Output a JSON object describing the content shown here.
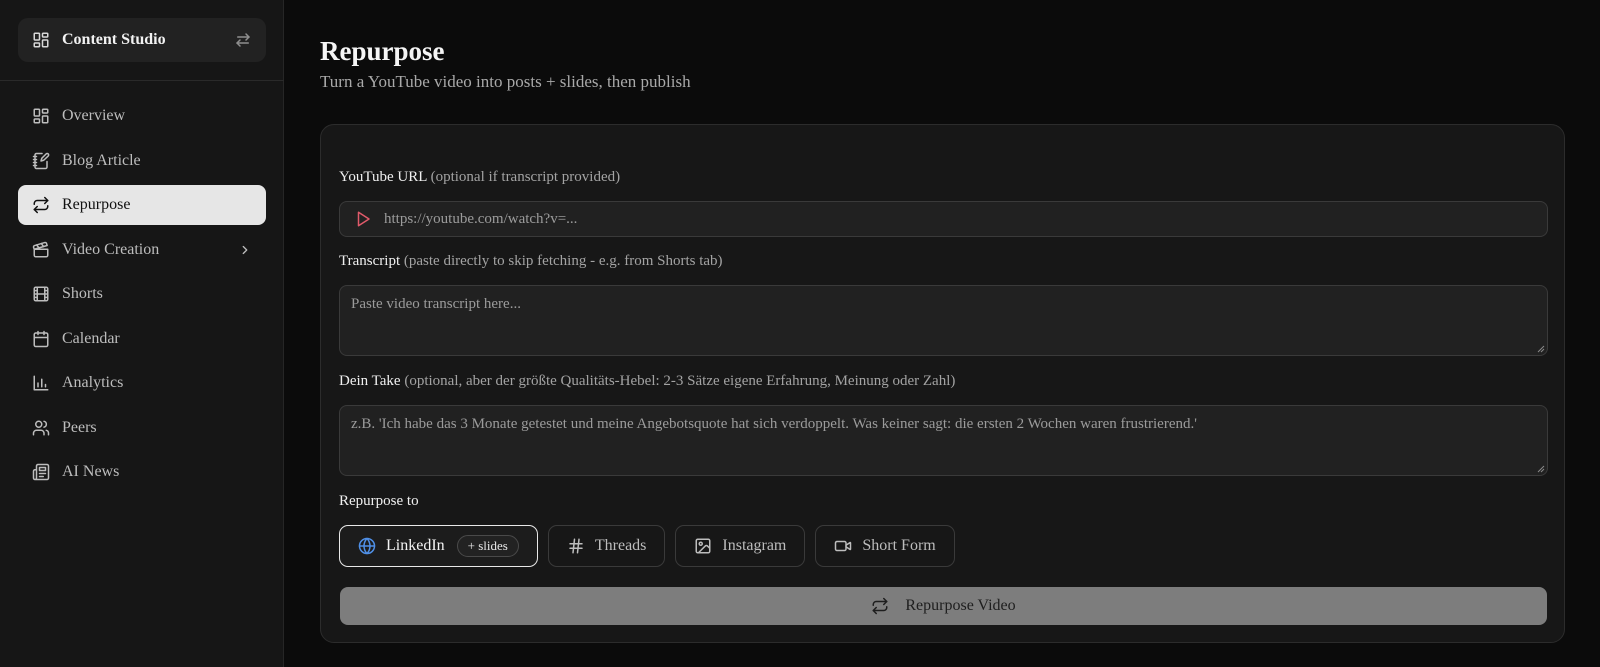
{
  "sidebar": {
    "brand": {
      "title": "Content Studio",
      "icon": "dashboard-icon",
      "toggle_icon": "swap-icon"
    },
    "items": [
      {
        "label": "Overview",
        "icon": "dashboard-icon"
      },
      {
        "label": "Blog Article",
        "icon": "notebook-pen-icon"
      },
      {
        "label": "Repurpose",
        "icon": "repeat-icon",
        "active": true
      },
      {
        "label": "Video Creation",
        "icon": "clapperboard-icon",
        "has_submenu": true
      },
      {
        "label": "Shorts",
        "icon": "film-icon"
      },
      {
        "label": "Calendar",
        "icon": "calendar-icon"
      },
      {
        "label": "Analytics",
        "icon": "bar-chart-icon"
      },
      {
        "label": "Peers",
        "icon": "users-icon"
      },
      {
        "label": "AI News",
        "icon": "newspaper-icon"
      }
    ]
  },
  "header": {
    "title": "Repurpose",
    "subtitle": "Turn a YouTube video into posts + slides, then publish"
  },
  "form": {
    "url": {
      "label": "YouTube URL",
      "hint": "(optional if transcript provided)",
      "placeholder": "https://youtube.com/watch?v=...",
      "icon": "play-icon"
    },
    "transcript": {
      "label": "Transcript",
      "hint": "(paste directly to skip fetching - e.g. from Shorts tab)",
      "placeholder": "Paste video transcript here..."
    },
    "take": {
      "label": "Dein Take",
      "hint": "(optional, aber der größte Qualitäts-Hebel: 2-3 Sätze eigene Erfahrung, Meinung oder Zahl)",
      "placeholder": "z.B. 'Ich habe das 3 Monate getestet und meine Angebotsquote hat sich verdoppelt. Was keiner sagt: die ersten 2 Wochen waren frustrierend.'"
    },
    "targets_label": "Repurpose to",
    "targets": [
      {
        "label": "LinkedIn",
        "icon": "globe-icon",
        "badge": "+ slides",
        "selected": true
      },
      {
        "label": "Threads",
        "icon": "hash-icon"
      },
      {
        "label": "Instagram",
        "icon": "image-icon"
      },
      {
        "label": "Short Form",
        "icon": "video-icon"
      }
    ],
    "submit_label": "Repurpose Video",
    "submit_icon": "repeat-icon"
  },
  "colors": {
    "accent_play": "#e05a6a",
    "accent_globe": "#4f8fe6",
    "active_nav_bg": "#e6e6e6"
  }
}
